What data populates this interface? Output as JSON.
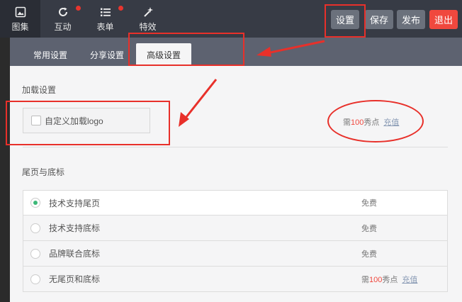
{
  "topbar": {
    "nav": [
      {
        "label": "图集",
        "icon": "image-icon",
        "active": true,
        "badge": false
      },
      {
        "label": "互动",
        "icon": "refresh-icon",
        "active": false,
        "badge": true
      },
      {
        "label": "表单",
        "icon": "list-icon",
        "active": false,
        "badge": true
      },
      {
        "label": "特效",
        "icon": "sparkle-icon",
        "active": false,
        "badge": false
      }
    ],
    "buttons": {
      "settings": "设置",
      "save": "保存",
      "publish": "发布",
      "exit": "退出"
    }
  },
  "tabs": [
    "常用设置",
    "分享设置",
    "高级设置"
  ],
  "active_tab": "高级设置",
  "loading": {
    "title": "加载设置",
    "checkbox_label": "自定义加载logo",
    "checked": false,
    "price_prefix": "需",
    "price_num": "100",
    "price_suffix": "秀点",
    "recharge": "充值"
  },
  "footer": {
    "title": "尾页与底标",
    "options": [
      {
        "label": "技术支持尾页",
        "price": "免费",
        "selected": true
      },
      {
        "label": "技术支持底标",
        "price": "免费",
        "selected": false
      },
      {
        "label": "品牌联合底标",
        "price": "免费",
        "selected": false
      },
      {
        "label": "无尾页和底标",
        "price_prefix": "需",
        "price_num": "100",
        "price_suffix": "秀点",
        "recharge": "充值",
        "selected": false
      }
    ]
  },
  "colors": {
    "accent_red": "#e8302a",
    "topbar": "#373b45",
    "selected_radio": "#3cb878"
  }
}
